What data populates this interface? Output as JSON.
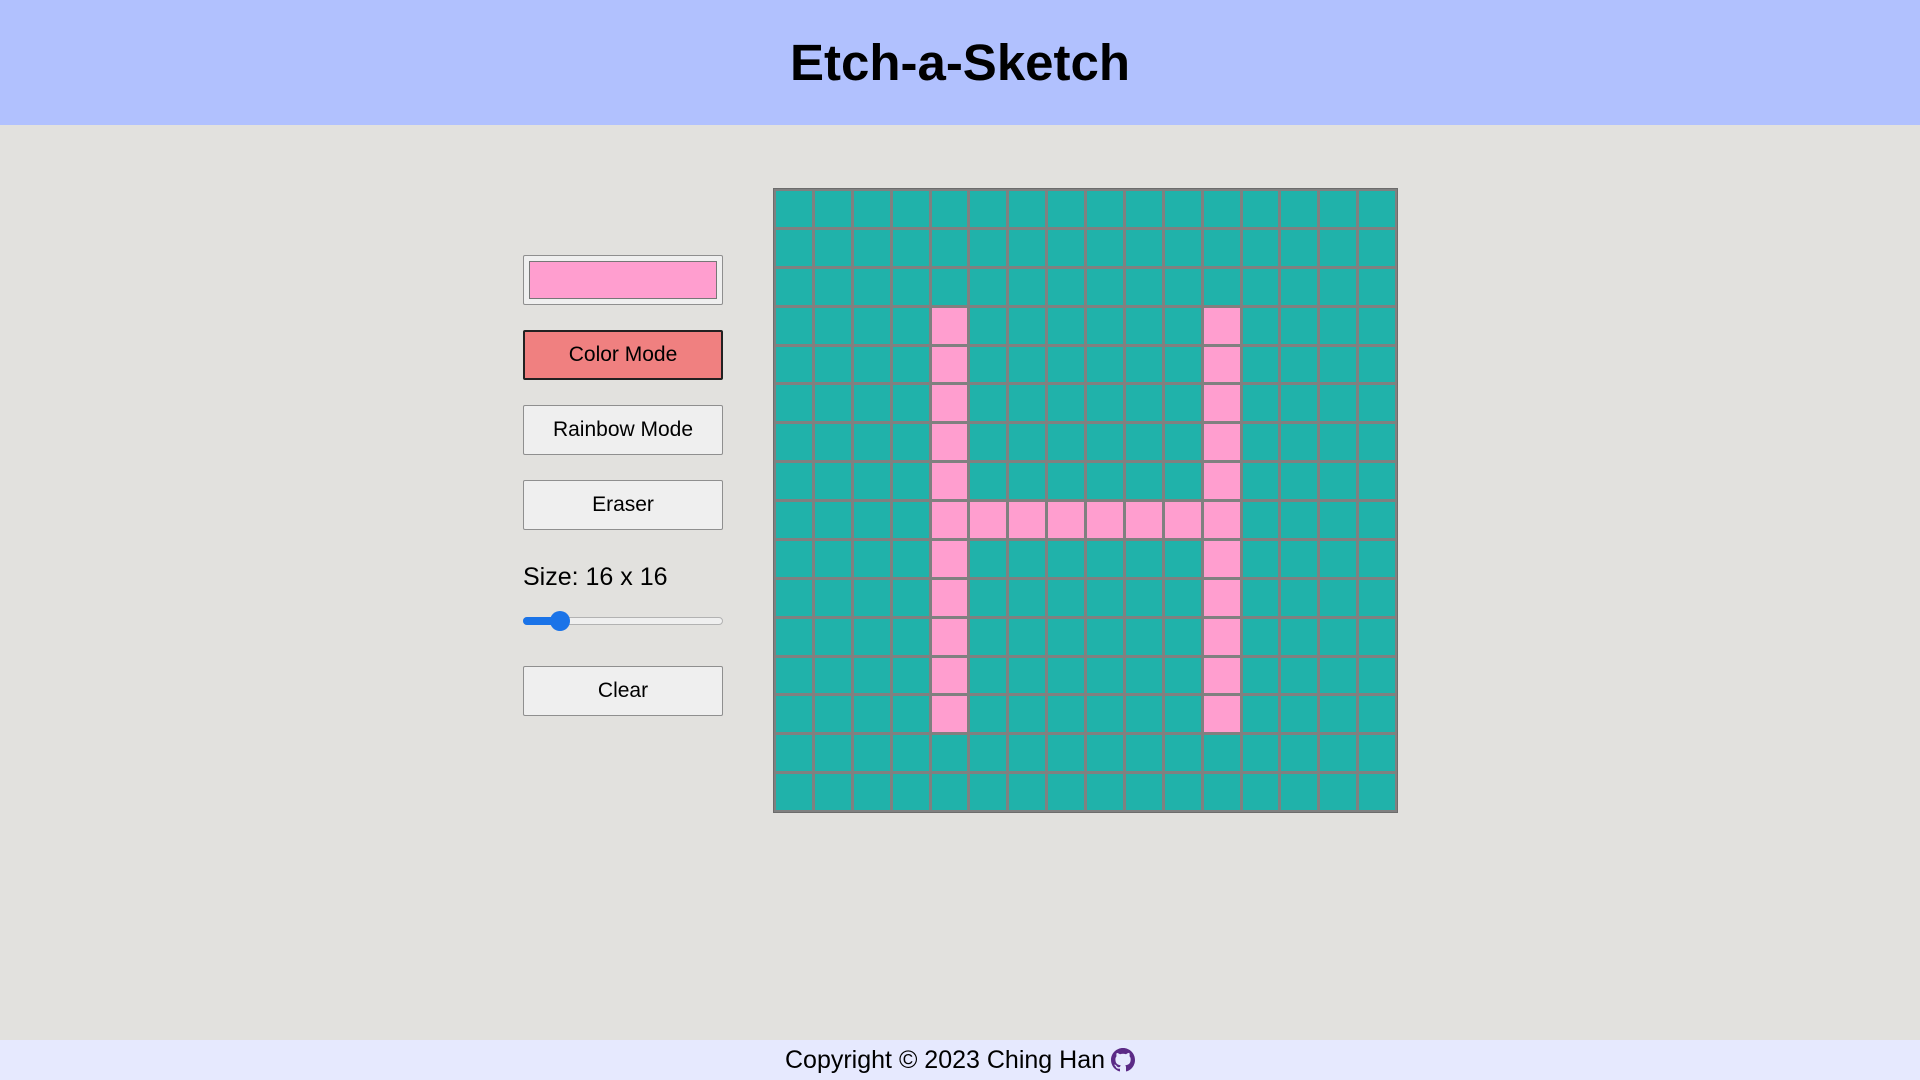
{
  "header": {
    "title": "Etch-a-Sketch"
  },
  "controls": {
    "color_value": "#ff9ecf",
    "color_mode_label": "Color Mode",
    "rainbow_mode_label": "Rainbow Mode",
    "eraser_label": "Eraser",
    "size_label": "Size: 16 x 16",
    "size_min": 1,
    "size_max": 100,
    "size_value": 16,
    "clear_label": "Clear",
    "active_mode": "color"
  },
  "grid": {
    "size": 16,
    "default_color": "#20b2aa",
    "paint_color": "#ff9ecf",
    "line_color": "#808080",
    "painted": [
      [
        3,
        4
      ],
      [
        4,
        4
      ],
      [
        5,
        4
      ],
      [
        6,
        4
      ],
      [
        7,
        4
      ],
      [
        8,
        4
      ],
      [
        9,
        4
      ],
      [
        10,
        4
      ],
      [
        11,
        4
      ],
      [
        12,
        4
      ],
      [
        13,
        4
      ],
      [
        3,
        11
      ],
      [
        4,
        11
      ],
      [
        5,
        11
      ],
      [
        6,
        11
      ],
      [
        7,
        11
      ],
      [
        8,
        11
      ],
      [
        9,
        11
      ],
      [
        10,
        11
      ],
      [
        11,
        11
      ],
      [
        12,
        11
      ],
      [
        13,
        11
      ],
      [
        8,
        5
      ],
      [
        8,
        6
      ],
      [
        8,
        7
      ],
      [
        8,
        8
      ],
      [
        8,
        9
      ],
      [
        8,
        10
      ]
    ]
  },
  "footer": {
    "text": "Copyright © 2023 Ching Han",
    "icon": "github-icon"
  }
}
